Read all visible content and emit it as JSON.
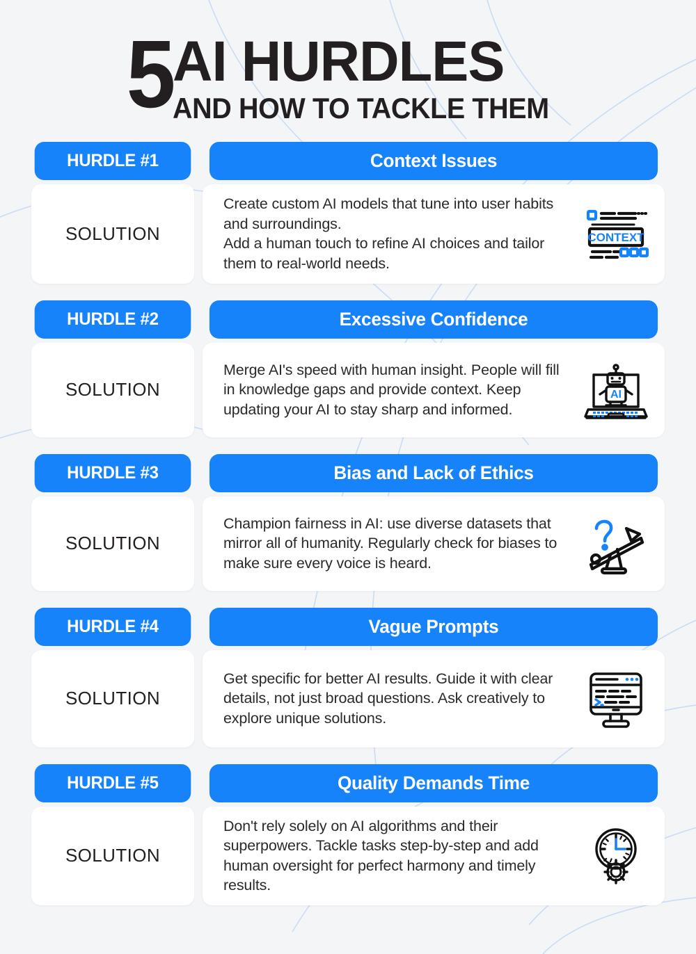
{
  "header": {
    "number": "5",
    "title_main": "AI HURDLES",
    "title_sub": "AND HOW TO TACKLE THEM"
  },
  "colors": {
    "accent_blue": "#1783fb",
    "background": "#f4f5f7",
    "card": "#ffffff",
    "text_dark": "#231f20",
    "curve_line": "#c9dcf5"
  },
  "labels": {
    "solution": "SOLUTION"
  },
  "hurdles": [
    {
      "badge": "HURDLE #1",
      "title": "Context Issues",
      "solution_label": "SOLUTION",
      "body": "Create custom AI models that tune into user habits and surroundings.\nAdd a human touch to refine AI choices and tailor them to real-world needs.",
      "icon": "context-window-icon",
      "icon_text": "CONTEXT"
    },
    {
      "badge": "HURDLE #2",
      "title": "Excessive Confidence",
      "solution_label": "SOLUTION",
      "body": "Merge AI's speed with human insight. People will fill in knowledge gaps and provide context. Keep updating your AI to stay sharp and informed.",
      "icon": "robot-laptop-icon",
      "icon_text": "AI"
    },
    {
      "badge": "HURDLE #3",
      "title": "Bias and Lack of Ethics",
      "solution_label": "SOLUTION",
      "body": "Champion fairness in AI: use diverse datasets that mirror all of humanity. Regularly check for biases to make sure every voice is heard.",
      "icon": "unbalanced-scale-question-icon",
      "icon_text": "?"
    },
    {
      "badge": "HURDLE #4",
      "title": "Vague Prompts",
      "solution_label": "SOLUTION",
      "body": "Get specific for better AI results. Guide it with clear details, not just broad questions. Ask creatively to explore unique solutions.",
      "icon": "monitor-terminal-icon",
      "icon_text": ">_"
    },
    {
      "badge": "HURDLE #5",
      "title": "Quality Demands Time",
      "solution_label": "SOLUTION",
      "body": "Don't rely solely on AI algorithms and their superpowers. Tackle tasks step-by-step and add human oversight for perfect harmony and timely results.",
      "icon": "clock-gear-icon",
      "icon_text": ""
    }
  ]
}
